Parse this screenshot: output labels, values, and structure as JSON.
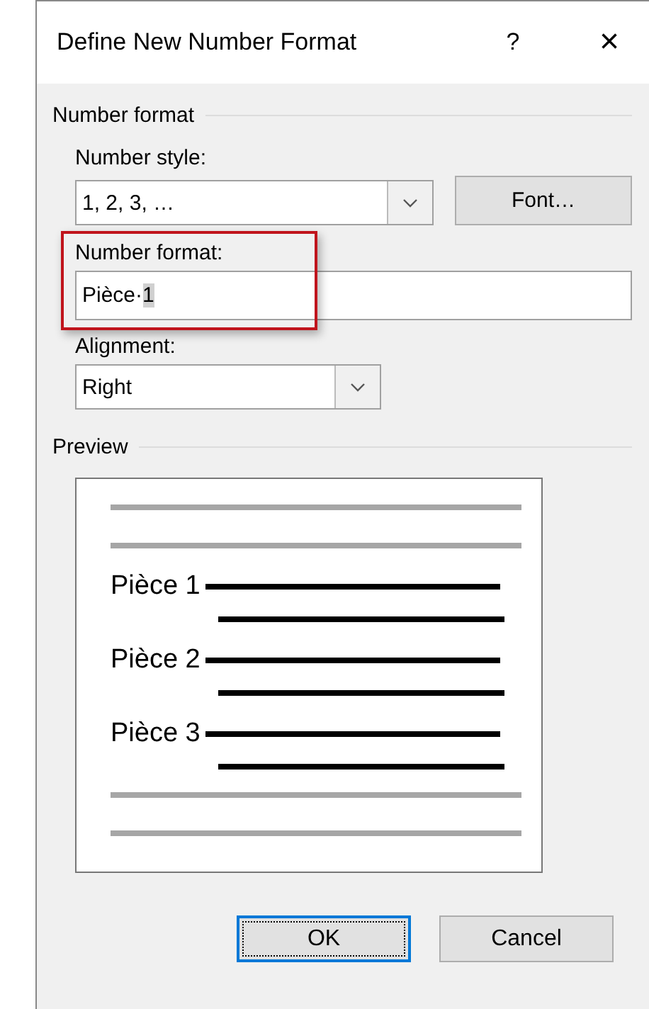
{
  "window": {
    "title": "Define New Number Format",
    "help": "?",
    "close": "×"
  },
  "number_format_group": {
    "title": "Number format",
    "number_style": {
      "label": "Number style:",
      "value": "1, 2, 3, …"
    },
    "font_button": "Font…",
    "number_format": {
      "label": "Number format:",
      "text": "Pièce·",
      "field": "1",
      "highlighted": true
    },
    "alignment": {
      "label": "Alignment:",
      "value": "Right"
    }
  },
  "preview": {
    "title": "Preview",
    "items": [
      {
        "label": "Pièce 1"
      },
      {
        "label": "Pièce 2"
      },
      {
        "label": "Pièce 3"
      }
    ]
  },
  "buttons": [
    {
      "label": "OK",
      "default": true
    },
    {
      "label": "Cancel",
      "default": false
    }
  ]
}
